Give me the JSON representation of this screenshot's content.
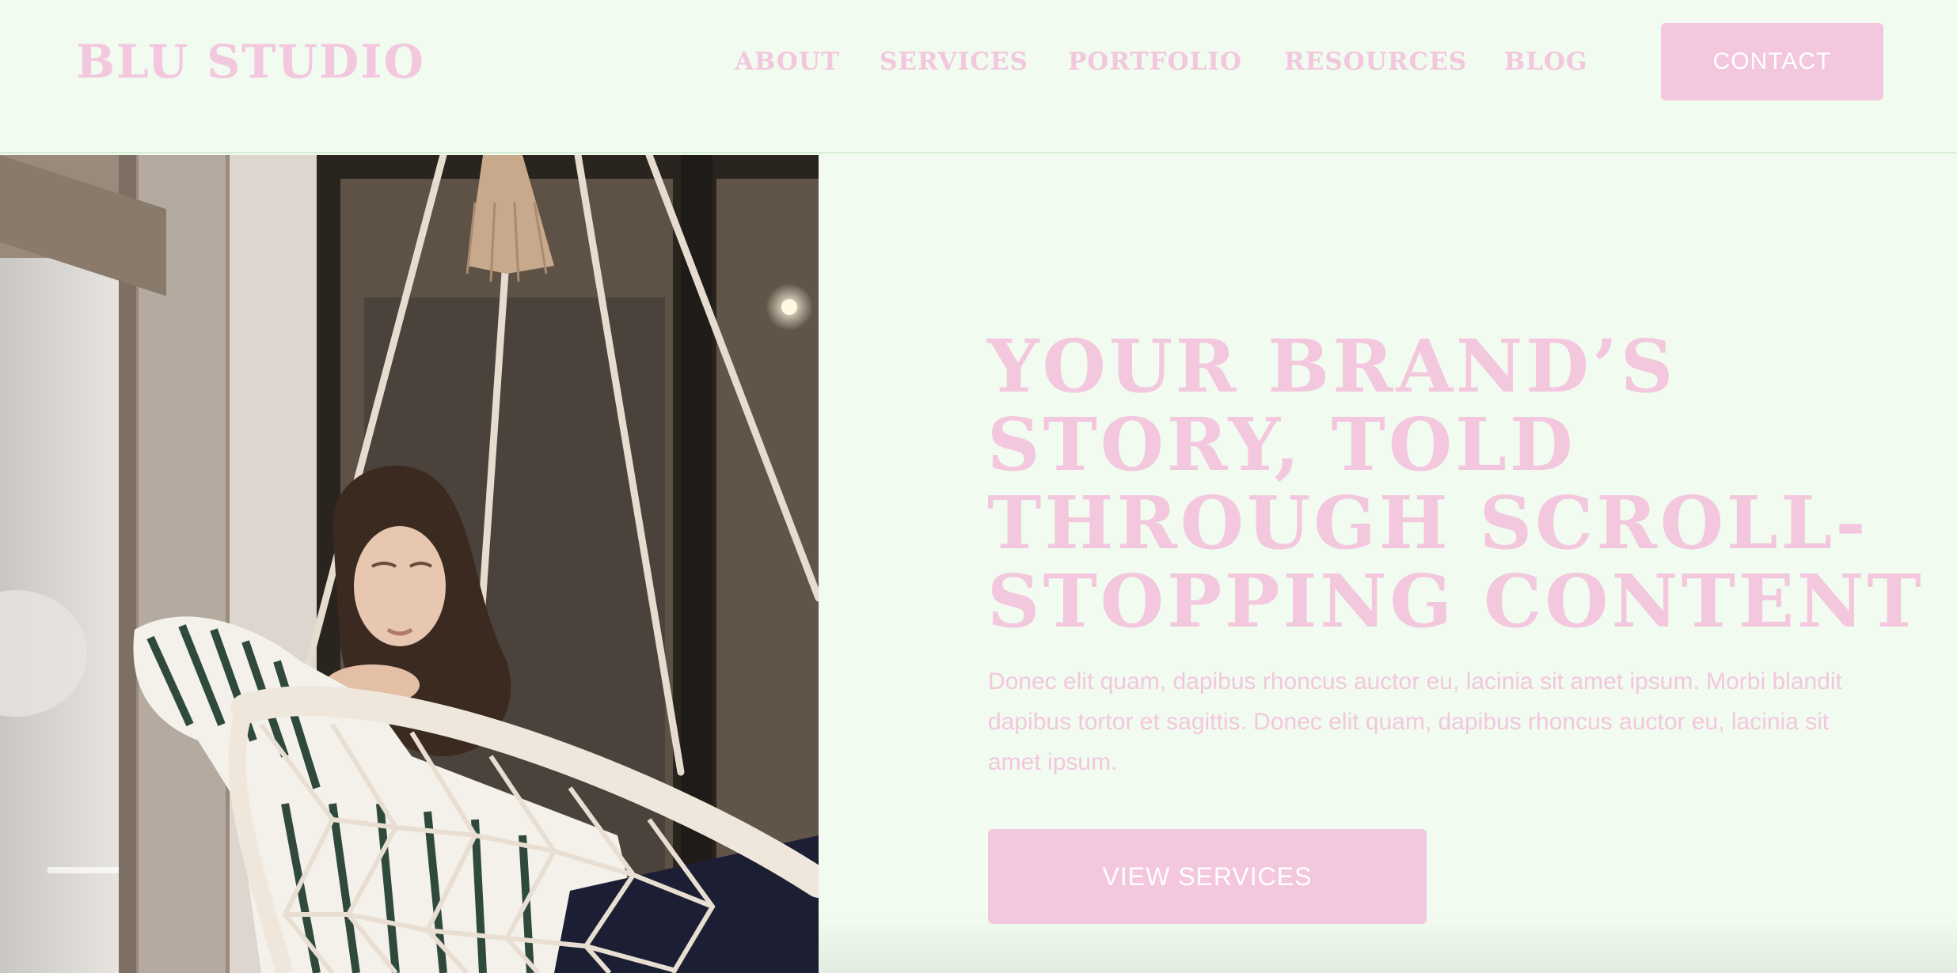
{
  "brand": {
    "logo_text": "BLU STUDIO"
  },
  "nav": {
    "items": [
      {
        "label": "ABOUT"
      },
      {
        "label": "SERVICES"
      },
      {
        "label": "PORTFOLIO"
      },
      {
        "label": "RESOURCES"
      },
      {
        "label": "BLOG"
      }
    ],
    "contact_label": "CONTACT"
  },
  "hero": {
    "title": "YOUR BRAND’S STORY, TOLD THROUGH SCROLL-STOPPING CONTENT",
    "body": "Donec elit quam, dapibus rhoncus auctor eu, lacinia sit amet ipsum. Morbi blandit dapibus tortor et sagittis. Donec elit quam, dapibus rhoncus auctor eu, lacinia sit amet ipsum.",
    "button_label": "VIEW SERVICES",
    "image_subject": "woman-in-hanging-rope-chair"
  },
  "colors": {
    "background": "#f1fbef",
    "accent_pink": "#f3c7de",
    "button_text": "#ffffff"
  }
}
